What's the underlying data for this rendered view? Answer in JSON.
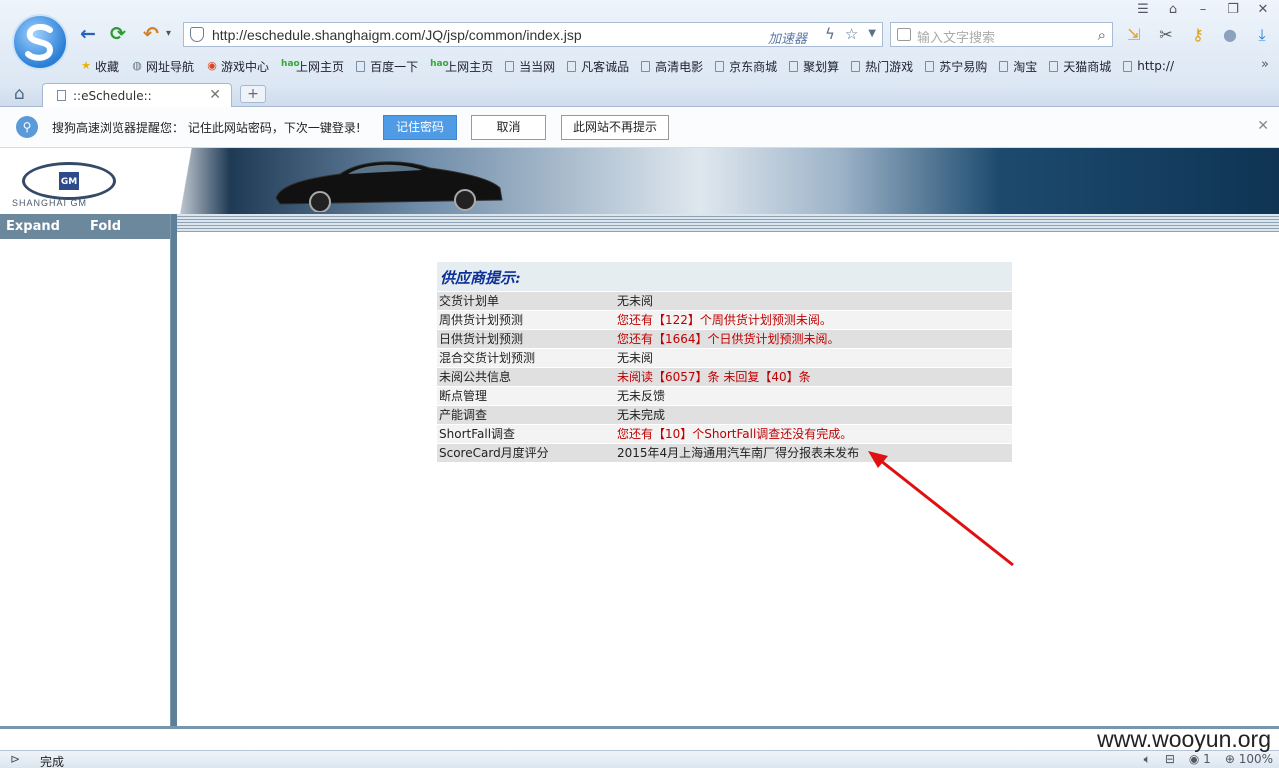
{
  "browser": {
    "url": "http://eschedule.shanghaigm.com/JQ/jsp/common/index.jsp",
    "accelerator_label": "加速器",
    "search_placeholder": "输入文字搜索",
    "bookmarks": [
      {
        "label": "收藏",
        "icon": "star-icon"
      },
      {
        "label": "网址导航",
        "icon": "globe-icon"
      },
      {
        "label": "游戏中心",
        "icon": "game-icon"
      },
      {
        "label": "上网主页",
        "icon": "hao-icon"
      },
      {
        "label": "百度一下",
        "icon": "page-icon"
      },
      {
        "label": "上网主页",
        "icon": "hao-icon"
      },
      {
        "label": "当当网",
        "icon": "page-icon"
      },
      {
        "label": "凡客诚品",
        "icon": "page-icon"
      },
      {
        "label": "高清电影",
        "icon": "page-icon"
      },
      {
        "label": "京东商城",
        "icon": "page-icon"
      },
      {
        "label": "聚划算",
        "icon": "page-icon"
      },
      {
        "label": "热门游戏",
        "icon": "page-icon"
      },
      {
        "label": "苏宁易购",
        "icon": "page-icon"
      },
      {
        "label": "淘宝",
        "icon": "page-icon"
      },
      {
        "label": "天猫商城",
        "icon": "page-icon"
      },
      {
        "label": "http://",
        "icon": "page-icon"
      }
    ],
    "tab_title": "::eSchedule::",
    "notification": {
      "message": "搜狗高速浏览器提醒您： 记住此网站密码，下次一键登录!",
      "remember_label": "记住密码",
      "cancel_label": "取消",
      "never_label": "此网站不再提示"
    },
    "status_text": "完成",
    "status_count": "1",
    "zoom": "100%"
  },
  "page": {
    "brand_name": "SHANGHAI GM",
    "brand_badge": "GM",
    "sidebar": {
      "expand_label": "Expand",
      "fold_label": "Fold"
    },
    "panel_title": "供应商提示:",
    "rows": [
      {
        "key": "交货计划单",
        "value": "无未阅"
      },
      {
        "key": "周供货计划预测",
        "value": "您还有【122】个周供货计划预测未阅。"
      },
      {
        "key": "日供货计划预测",
        "value": "您还有【1664】个日供货计划预测未阅。"
      },
      {
        "key": "混合交货计划预测",
        "value": "无未阅"
      },
      {
        "key": "未阅公共信息",
        "value": "未阅读【6057】条 未回复【40】条"
      },
      {
        "key": "断点管理",
        "value": "无未反馈"
      },
      {
        "key": "产能调查",
        "value": "无未完成"
      },
      {
        "key": "ShortFall调查",
        "value": "您还有【10】个ShortFall调查还没有完成。"
      },
      {
        "key": "ScoreCard月度评分",
        "value": "2015年4月上海通用汽车南厂得分报表未发布"
      }
    ],
    "alert_color": "#c00000"
  },
  "watermark": "www.wooyun.org"
}
